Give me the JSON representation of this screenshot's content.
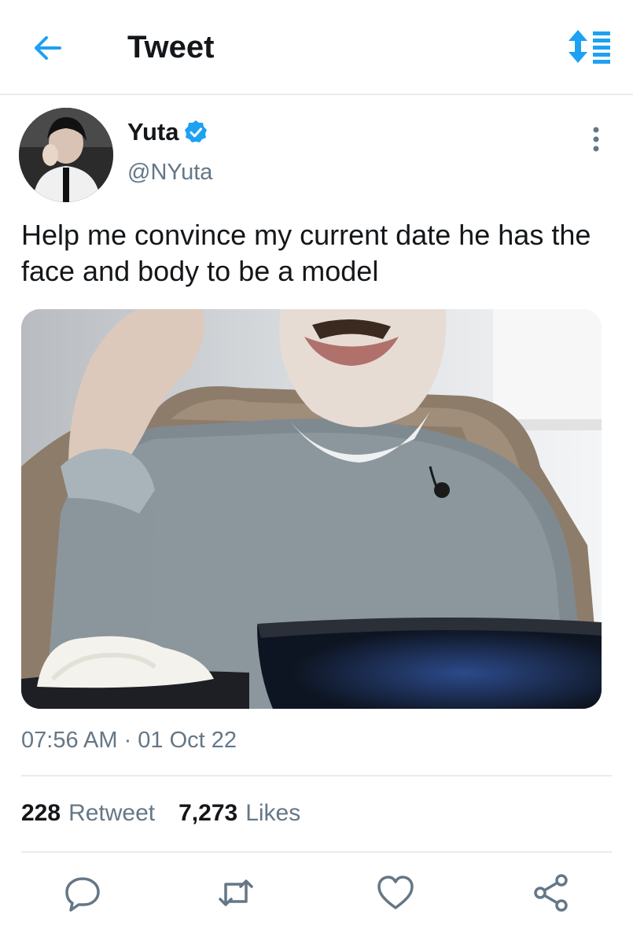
{
  "header": {
    "title": "Tweet",
    "back_icon": "arrow-left-icon",
    "sort_icon": "sort-icon",
    "accent_color": "#1da1f2"
  },
  "tweet": {
    "author": {
      "display_name": "Yuta",
      "handle": "@NYuta",
      "verified": true,
      "verified_icon": "verified-badge-icon"
    },
    "text": "Help me convince my current date he has the face and body to be a model",
    "media": {
      "type": "photo"
    },
    "timestamp": "07:56 AM · 01 Oct 22",
    "stats": {
      "retweets": "228",
      "retweets_label": "Retweet",
      "likes": "7,273",
      "likes_label": "Likes"
    }
  },
  "actions": [
    {
      "icon": "reply-icon"
    },
    {
      "icon": "retweet-icon"
    },
    {
      "icon": "like-icon"
    },
    {
      "icon": "share-icon"
    }
  ]
}
